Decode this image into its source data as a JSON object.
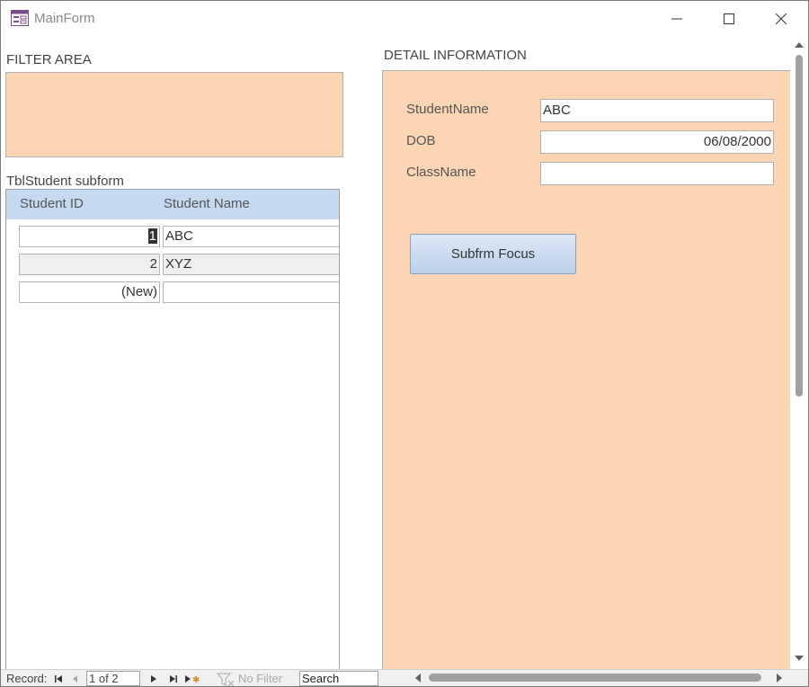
{
  "window": {
    "title": "MainForm"
  },
  "filter": {
    "label": "FILTER AREA"
  },
  "subform": {
    "label": "TblStudent subform",
    "columns": [
      "Student ID",
      "Student Name"
    ],
    "rows": [
      {
        "id": "1",
        "name": "ABC"
      },
      {
        "id": "2",
        "name": "XYZ"
      },
      {
        "id": "(New)",
        "name": ""
      }
    ]
  },
  "detail": {
    "label": "DETAIL INFORMATION",
    "fields": [
      {
        "label": "StudentName",
        "value": "ABC"
      },
      {
        "label": "DOB",
        "value": "06/08/2000"
      },
      {
        "label": "ClassName",
        "value": ""
      }
    ],
    "button_label": "Subfrm Focus"
  },
  "status": {
    "record_label": "Record:",
    "record_position": "1 of 2",
    "filter_label": "No Filter",
    "search_placeholder": "Search"
  },
  "colors": {
    "form_bg": "#fcd5b4",
    "header_bg": "#c5d9f1"
  }
}
